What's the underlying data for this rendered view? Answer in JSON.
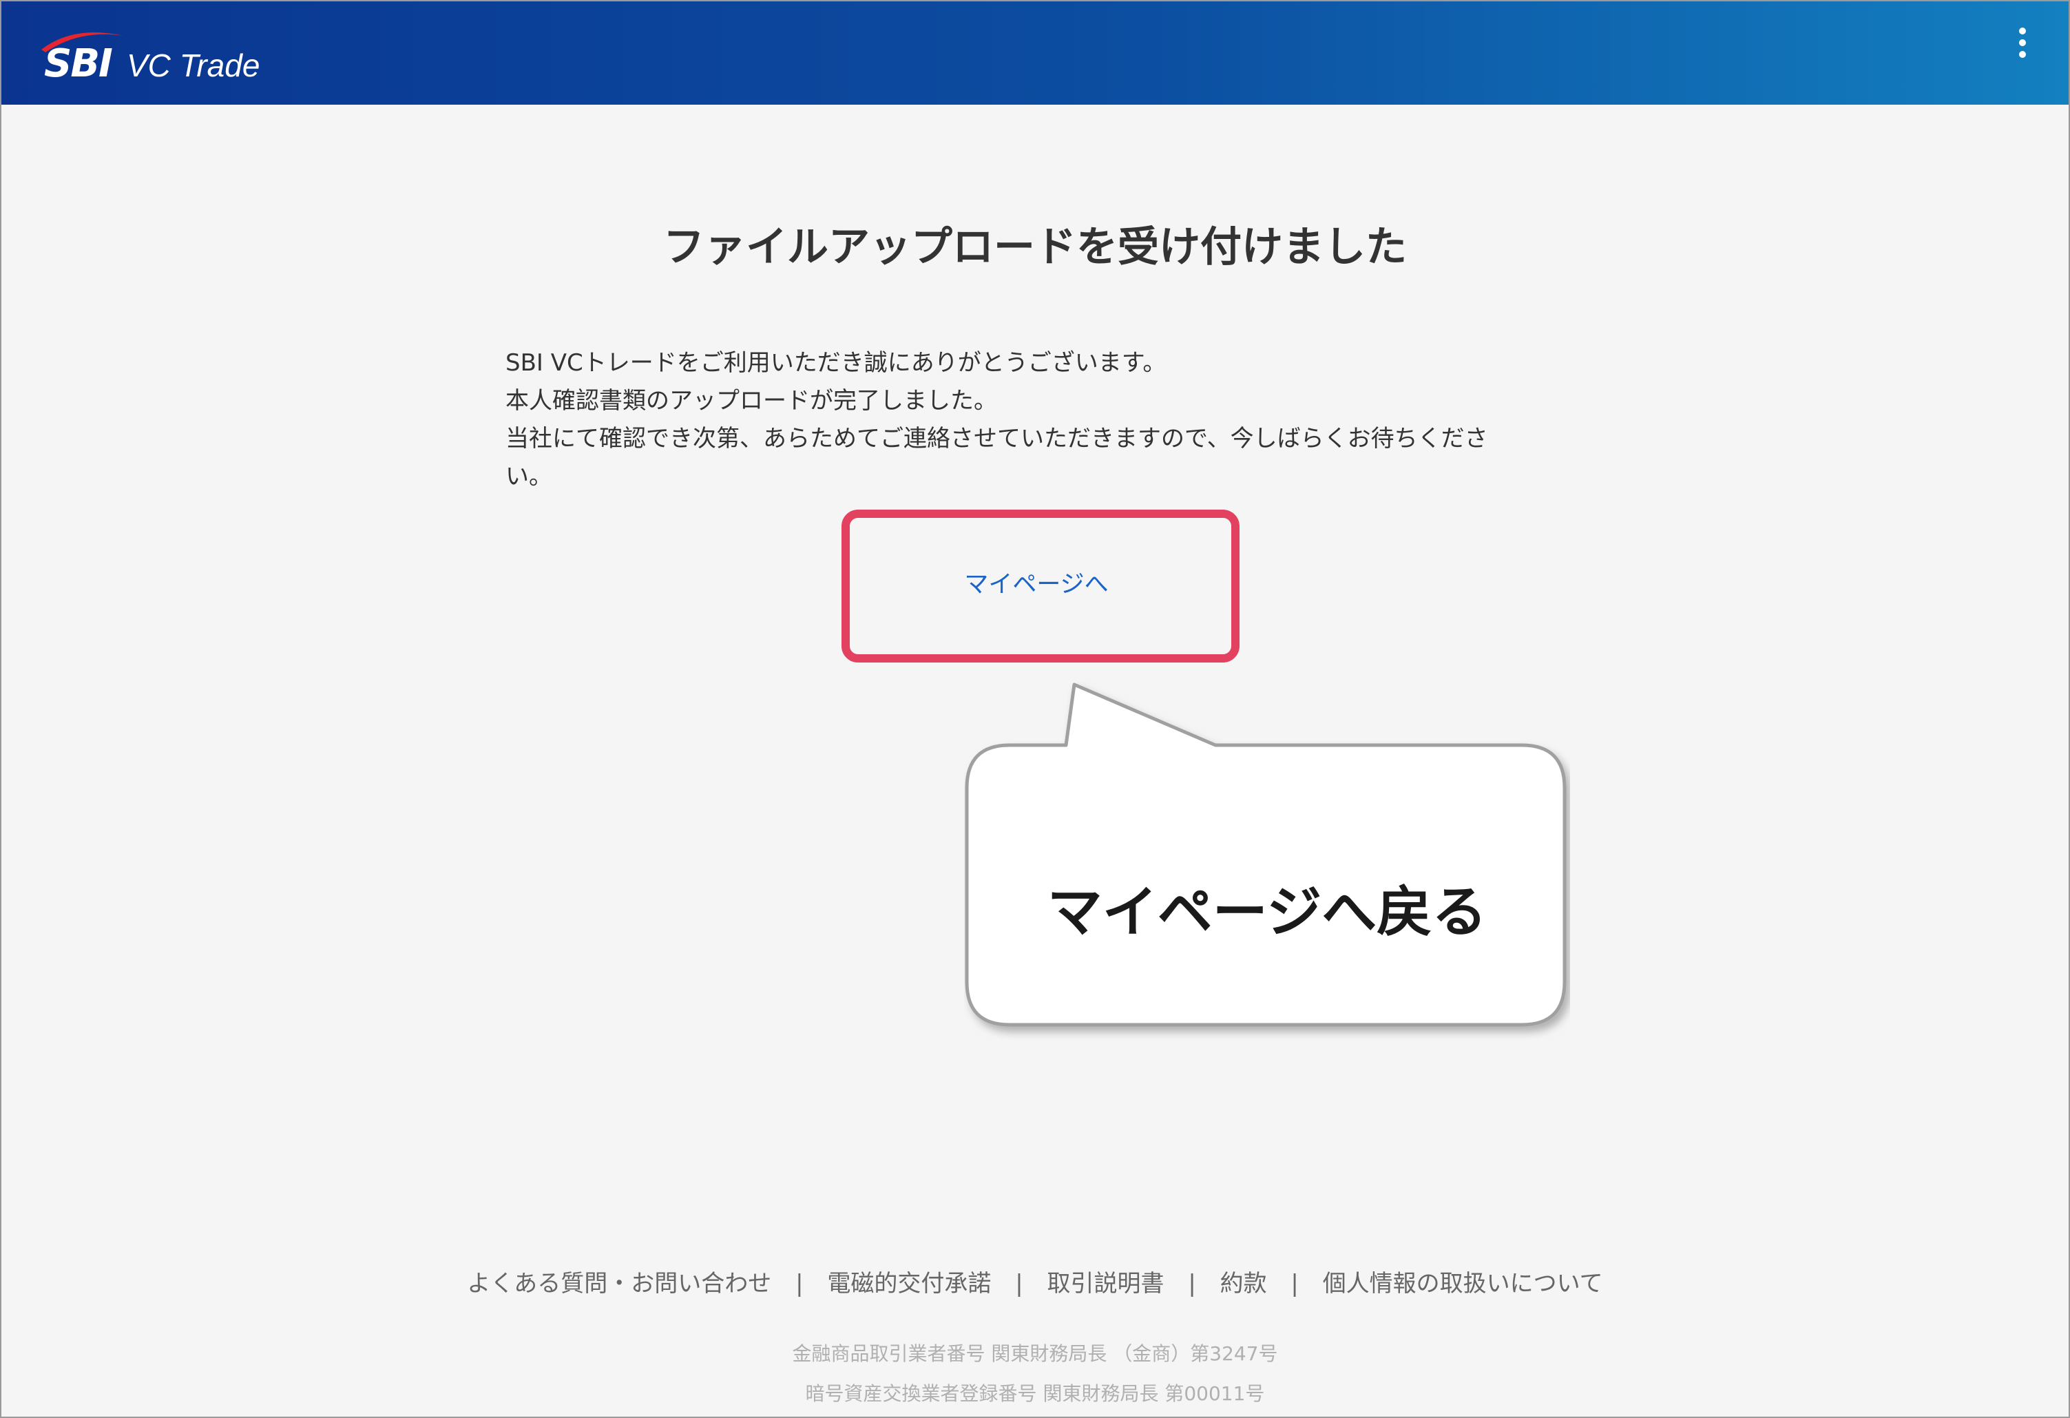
{
  "header": {
    "logo_mark": "SBI",
    "logo_text": "VC Trade",
    "menu_icon": "more-vertical-icon",
    "bg_color_start": "#0a3490",
    "bg_color_end": "#1380c0"
  },
  "main": {
    "title": "ファイルアップロードを受け付けました",
    "message_lines": [
      "SBI VCトレードをご利用いただき誠にありがとうございます。",
      "本人確認書類のアップロードが完了しました。",
      "当社にて確認でき次第、あらためてご連絡させていただきますので、今しばらくお待ちくださ",
      "い。"
    ],
    "mypage_link": "マイページへ",
    "link_color": "#1a63c8"
  },
  "annotation": {
    "highlight_color": "#e2415f",
    "callout_text": "マイページへ戻る"
  },
  "footer": {
    "links": [
      "よくある質問・お問い合わせ",
      "電磁的交付承諾",
      "取引説明書",
      "約款",
      "個人情報の取扱いについて"
    ],
    "separator": "|",
    "registration_1": "金融商品取引業者番号 関東財務局長 （金商）第3247号",
    "registration_2": "暗号資産交換業者登録番号 関東財務局長 第00011号"
  }
}
